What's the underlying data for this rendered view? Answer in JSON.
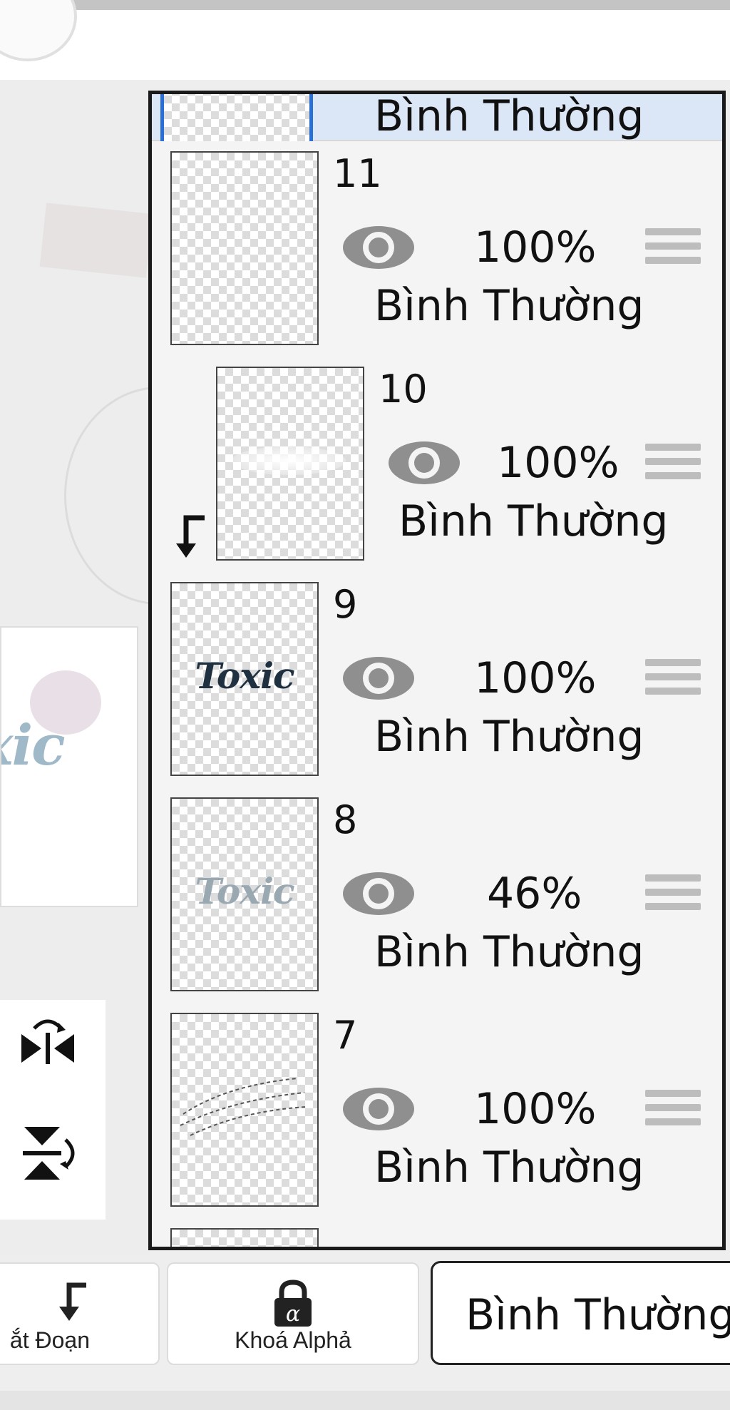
{
  "layers": [
    {
      "number": "",
      "opacity": "",
      "blend": "Bình Thường",
      "selected": true
    },
    {
      "number": "11",
      "opacity": "100%",
      "blend": "Bình Thường"
    },
    {
      "number": "10",
      "opacity": "100%",
      "blend": "Bình Thường",
      "clipped": true
    },
    {
      "number": "9",
      "opacity": "100%",
      "blend": "Bình Thường",
      "thumb_text": "Toxic"
    },
    {
      "number": "8",
      "opacity": "46%",
      "blend": "Bình Thường",
      "thumb_text": "Toxic"
    },
    {
      "number": "7",
      "opacity": "100%",
      "blend": "Bình Thường"
    }
  ],
  "bottom_bar": {
    "clip_label": "ắt Đoạn",
    "alpha_lock_label": "Khoá Alphả",
    "alpha_symbol": "α",
    "blend_mode_value": "Bình Thường"
  },
  "preview": {
    "text": "xic"
  },
  "colors": {
    "panel_border": "#1a1a1a",
    "selected_row": "#dbe7f6",
    "selected_thumb_border": "#2a6fd6",
    "eye": "#8f8f8f"
  },
  "icons": [
    "eye-icon",
    "drag-handle-icon",
    "clip-arrow-icon",
    "flip-horizontal-icon",
    "flip-vertical-icon",
    "lock-icon"
  ]
}
